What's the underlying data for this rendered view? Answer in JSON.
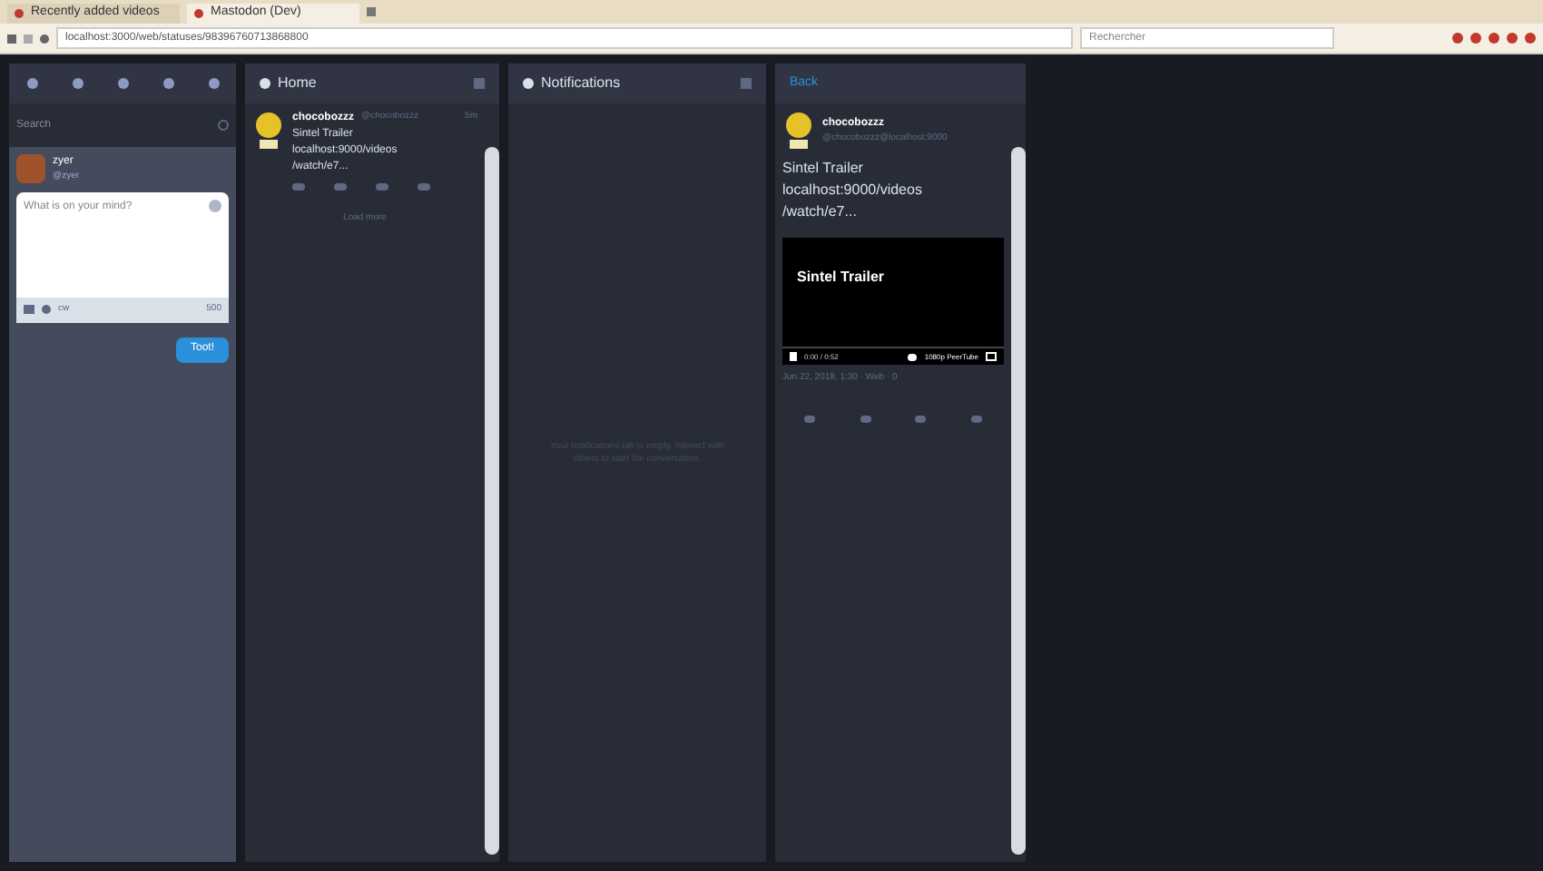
{
  "browser": {
    "tabs": [
      {
        "title": "Recently added videos",
        "selected": false
      },
      {
        "title": "Mastodon (Dev)",
        "selected": true
      }
    ],
    "url": "localhost:3000/web/statuses/98396760713868800",
    "search": {
      "placeholder": "Rechercher"
    }
  },
  "drawer": {
    "search": {
      "placeholder": "Search"
    },
    "account": {
      "name": "zyer",
      "handle": "@zyer"
    },
    "compose": {
      "placeholder": "What is on your mind?",
      "cw": "cw",
      "counter": "500",
      "button": "Toot!"
    }
  },
  "home": {
    "title": "Home",
    "status": {
      "name": "chocobozzz",
      "handle": "@chocobozzz",
      "time": "5m",
      "lines": [
        "Sintel Trailer",
        "localhost:9000/videos",
        "/watch/e7..."
      ]
    },
    "load_more": "Load more"
  },
  "notifications": {
    "title": "Notifications",
    "empty": "Your notifications tab is empty. Interact with others to start the conversation."
  },
  "detail": {
    "back": "Back",
    "name": "chocobozzz",
    "handle": "@chocobozzz@localhost:9000",
    "lines": [
      "Sintel Trailer",
      "localhost:9000/videos",
      "/watch/e7..."
    ],
    "video": {
      "title": "Sintel Trailer",
      "time": "0:00 / 0:52",
      "quality": "1080p PeerTube"
    },
    "meta": "Jun 22, 2018, 1:30 · Web · 0"
  }
}
